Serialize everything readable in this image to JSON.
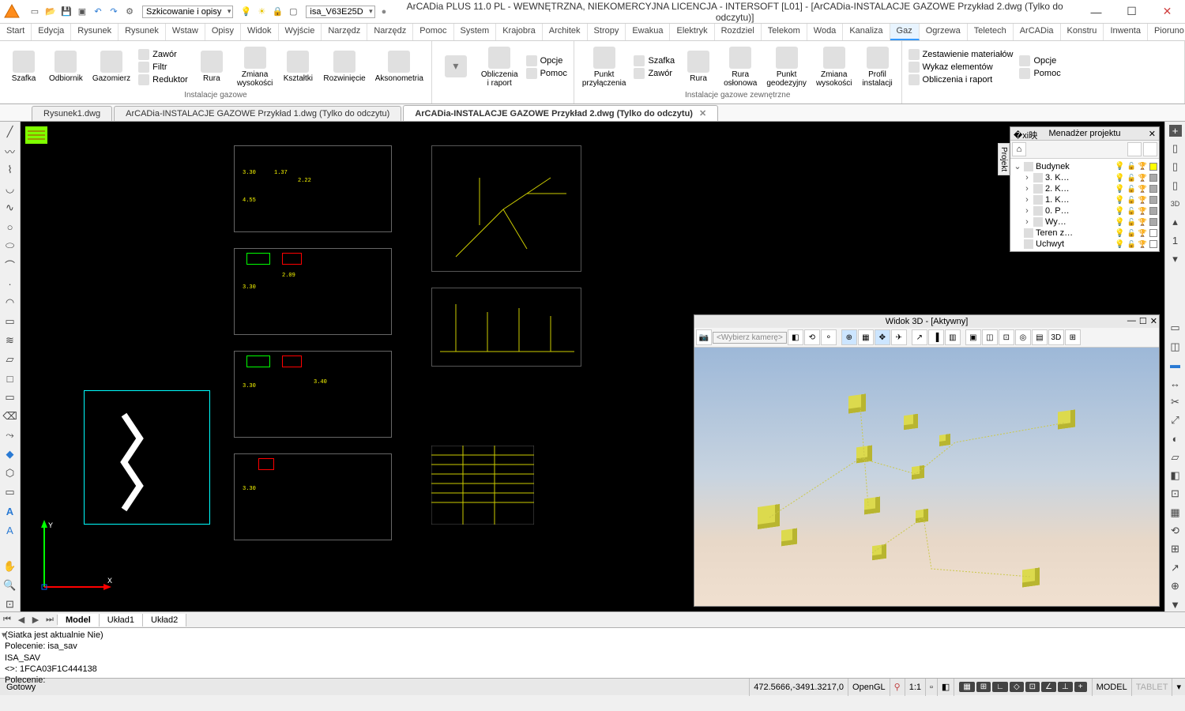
{
  "titlebar": {
    "combo1": "Szkicowanie i opisy",
    "combo2": "isa_V63E25D",
    "title": "ArCADia PLUS 11.0 PL - WEWNĘTRZNA, NIEKOMERCYJNA LICENCJA - INTERSOFT [L01] - [ArCADia-INSTALACJE GAZOWE Przykład 2.dwg (Tylko do odczytu)]"
  },
  "ribtabs": [
    "Start",
    "Edycja",
    "Rysunek",
    "Rysunek",
    "Wstaw",
    "Opisy",
    "Widok",
    "Wyjście",
    "Narzędz",
    "Narzędz",
    "Pomoc",
    "System",
    "Krajobra",
    "Architek",
    "Stropy",
    "Ewakua",
    "Elektryk",
    "Rozdziel",
    "Telekom",
    "Woda",
    "Kanaliza",
    "Gaz",
    "Ogrzewa",
    "Teletech",
    "ArCADia",
    "Konstru",
    "Inwenta",
    "Pioruno"
  ],
  "ribtab_active": "Gaz",
  "ribbon": {
    "g1": {
      "btns": [
        {
          "name": "szafka",
          "label": "Szafka"
        },
        {
          "name": "odbiornik",
          "label": "Odbiornik"
        },
        {
          "name": "gazomierz",
          "label": "Gazomierz"
        }
      ],
      "stack": [
        {
          "name": "zawor",
          "label": "Zawór"
        },
        {
          "name": "filtr",
          "label": "Filtr"
        },
        {
          "name": "reduktor",
          "label": "Reduktor"
        }
      ],
      "btns2": [
        {
          "name": "rura",
          "label": "Rura"
        },
        {
          "name": "zmiana-wys",
          "label": "Zmiana\nwysokości"
        },
        {
          "name": "ksztaltki",
          "label": "Kształtki"
        },
        {
          "name": "rozwiniecie",
          "label": "Rozwinięcie"
        },
        {
          "name": "aksonometria",
          "label": "Aksonometria"
        }
      ],
      "title": "Instalacje gazowe"
    },
    "g2": {
      "btns": [
        {
          "name": "obliczenia",
          "label": "Obliczenia\ni raport"
        }
      ],
      "stack": [
        {
          "name": "opcje",
          "label": "Opcje"
        },
        {
          "name": "pomoc",
          "label": "Pomoc"
        }
      ]
    },
    "g3": {
      "btns": [
        {
          "name": "punkt-przyl",
          "label": "Punkt\nprzyłączenia"
        }
      ],
      "stack": [
        {
          "name": "szafka2",
          "label": "Szafka"
        },
        {
          "name": "zawor2",
          "label": "Zawór"
        }
      ],
      "btns2": [
        {
          "name": "rura2",
          "label": "Rura"
        },
        {
          "name": "rura-oslon",
          "label": "Rura\nosłonowa"
        },
        {
          "name": "punkt-geo",
          "label": "Punkt\ngeodezyjny"
        },
        {
          "name": "zmiana-wys2",
          "label": "Zmiana\nwysokości"
        },
        {
          "name": "profil",
          "label": "Profil\ninstalacji"
        }
      ],
      "title": "Instalacje gazowe zewnętrzne"
    },
    "g4": {
      "stack": [
        {
          "name": "zestawienie",
          "label": "Zestawienie materiałów"
        },
        {
          "name": "wykaz",
          "label": "Wykaz elementów"
        },
        {
          "name": "obliczenia2",
          "label": "Obliczenia i raport"
        }
      ],
      "stack2": [
        {
          "name": "opcje2",
          "label": "Opcje"
        },
        {
          "name": "pomoc2",
          "label": "Pomoc"
        }
      ]
    }
  },
  "doctabs": [
    {
      "label": "Rysunek1.dwg",
      "active": false
    },
    {
      "label": "ArCADia-INSTALACJE GAZOWE Przykład 1.dwg (Tylko do odczytu)",
      "active": false
    },
    {
      "label": "ArCADia-INSTALACJE GAZOWE Przykład 2.dwg (Tylko do odczytu)",
      "active": true
    }
  ],
  "ytxt": "Y",
  "xtxt": "X",
  "pm": {
    "title": "Menadżer projektu",
    "sidelabel": "Projekt",
    "tree": [
      {
        "indent": 0,
        "tw": "⌄",
        "label": "Budynek",
        "sw": "#ff0"
      },
      {
        "indent": 1,
        "tw": "›",
        "label": "3. K…",
        "sw": "#aaa"
      },
      {
        "indent": 1,
        "tw": "›",
        "label": "2. K…",
        "sw": "#aaa"
      },
      {
        "indent": 1,
        "tw": "›",
        "label": "1. K…",
        "sw": "#aaa"
      },
      {
        "indent": 1,
        "tw": "›",
        "label": "0. P…",
        "sw": "#aaa"
      },
      {
        "indent": 1,
        "tw": "›",
        "label": "Wy…",
        "sw": "#aaa"
      },
      {
        "indent": 0,
        "tw": "",
        "label": "Teren z…",
        "sw": ""
      },
      {
        "indent": 0,
        "tw": "",
        "label": "Uchwyt",
        "sw": ""
      }
    ]
  },
  "v3d": {
    "title": "Widok 3D - [Aktywny]",
    "camera": "<Wybierz kamerę>"
  },
  "sheets": {
    "tabs": [
      "Model",
      "Układ1",
      "Układ2"
    ],
    "active": "Model"
  },
  "cmd": {
    "l1": "(Siatka jest aktualnie Nie)",
    "l2": "Polecenie: isa_sav",
    "l3": "ISA_SAV",
    "l4": "<>: 1FCA03F1C444138",
    "l5": "Polecenie:"
  },
  "status": {
    "ready": "Gotowy",
    "coords": "472.5666,-3491.3217,0",
    "opengl": "OpenGL",
    "scale": "1:1",
    "model": "MODEL",
    "tablet": "TABLET"
  }
}
